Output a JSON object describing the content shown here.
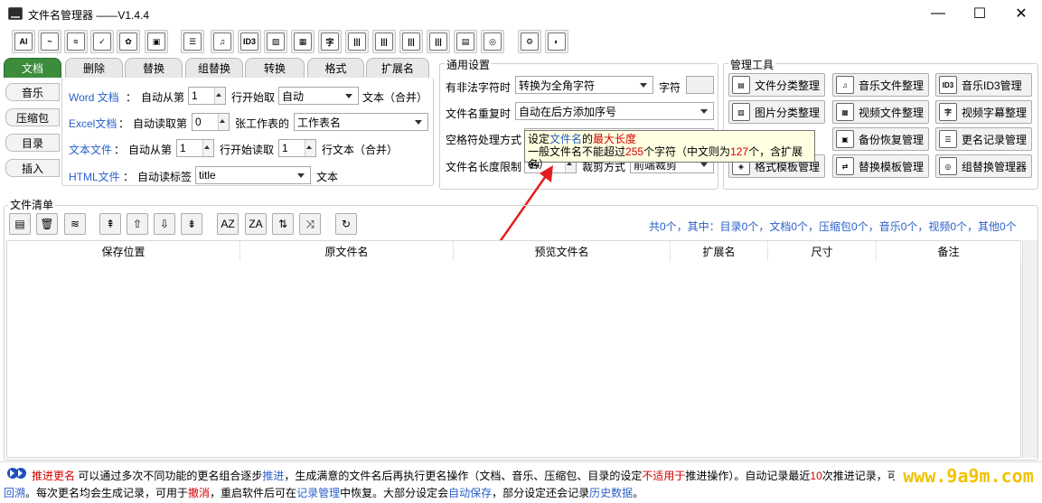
{
  "window": {
    "title": "文件名管理器 ——V1.4.4",
    "minimize": "—",
    "maximize": "☐",
    "close": "✕"
  },
  "toolbar": {
    "buttons": [
      "AI",
      "~",
      "≈",
      "✓",
      "✿",
      "▣",
      "☰",
      "♫",
      "ID3",
      "▨",
      "▦",
      "字",
      "|||",
      "|||",
      "|||",
      "|||",
      "▤",
      "◎",
      "⚙",
      "◐"
    ]
  },
  "tabs": [
    "文档",
    "删除",
    "替换",
    "组替换",
    "转换",
    "格式",
    "扩展名"
  ],
  "side_tabs": [
    "音乐",
    "压缩包",
    "目录",
    "插入"
  ],
  "doc": {
    "word": {
      "label": "Word 文档",
      "colon": "：",
      "text1": "自动从第",
      "value": "1",
      "text2": "行开始取",
      "mode": "自动",
      "text3": "文本（合并）"
    },
    "excel": {
      "label": "Excel文档",
      "colon": "：",
      "text1": "自动读取第",
      "value": "0",
      "text2": "张工作表的",
      "sheet": "工作表名"
    },
    "text": {
      "label": "文本文件",
      "colon": "：",
      "text1": "自动从第",
      "value": "1",
      "text2": "行开始读取",
      "value2": "1",
      "text3": "行文本（合并）"
    },
    "html": {
      "label": "HTML文件",
      "colon": "：",
      "text1": "自动读标签",
      "tag": "title",
      "text2": "文本"
    }
  },
  "general": {
    "title": "通用设置",
    "illegal_label": "有非法字符时",
    "illegal_value": "转换为全角字符",
    "char_label": "字符",
    "dup_label": "文件名重复时",
    "dup_value": "自动在后方添加序号",
    "space_label": "空格符处理方式",
    "len_label": "文件名长度限制",
    "len_value": "64",
    "cut_label": "裁剪方式",
    "cut_value": "前端裁剪"
  },
  "tooltip": {
    "l1a": "设定",
    "l1b": "文件名",
    "l1c": "的",
    "l1d": "最大长度",
    "l2a": "一般文件名不能超过",
    "l2b": "255",
    "l2c": "个字符（中文则为",
    "l2d": "127",
    "l2e": "个，含扩展名）"
  },
  "manage": {
    "title": "管理工具",
    "buttons": [
      {
        "icon": "▤",
        "label": "文件分类整理"
      },
      {
        "icon": "♫",
        "label": "音乐文件整理"
      },
      {
        "icon": "ID3",
        "label": "音乐ID3管理"
      },
      {
        "icon": "▨",
        "label": "图片分类整理"
      },
      {
        "icon": "▦",
        "label": "视频文件整理"
      },
      {
        "icon": "字",
        "label": "视频字幕整理"
      },
      {
        "icon": "▣",
        "label": "备份恢复管理"
      },
      {
        "icon": "☰",
        "label": "更名记录管理"
      },
      {
        "icon": "◈",
        "label": "格式模板管理"
      },
      {
        "icon": "⇄",
        "label": "替换模板管理"
      },
      {
        "icon": "◎",
        "label": "组替换管理器"
      }
    ]
  },
  "filelist": {
    "title": "文件清单",
    "buttons": [
      "▤",
      "🗑",
      "≋",
      "⇞",
      "⇧",
      "⇩",
      "⇟",
      "AZ",
      "ZA",
      "⇅",
      "⤨",
      "↻"
    ],
    "stats": "共0个，其中：目录0个，文档0个，压缩包0个，音乐0个，视频0个，其他0个",
    "columns": [
      "保存位置",
      "原文件名",
      "预览文件名",
      "扩展名",
      "尺寸",
      "备注"
    ]
  },
  "status": {
    "s1": "推进更名",
    "s2": " 可以通过多次不同功能的更名组合逐步",
    "s3": "推进",
    "s4": "，生成满意的文件名后再执行更名操作（文档、音乐、压缩包、目录的设定",
    "s5": "不适用于",
    "s6": "推进操作）。自动记录最近",
    "s7": "10",
    "s8": "次推进记录，可",
    "s9": "回溯",
    "s10": "。每次更名均会生成记录，可用于",
    "s11": "撤消",
    "s12": "，重启软件后可在",
    "s13": "记录管理",
    "s14": "中恢复。大部分设定会",
    "s15": "自动保存",
    "s16": "，部分设定还会记录",
    "s17": "历史数据",
    "s18": "。"
  },
  "watermark": "www.9a9m.com",
  "colors": {
    "accent_green": "#3c8c3c",
    "link_blue": "#2a5fc9",
    "emphasis_red": "#d40000",
    "arrow_red": "#e02020",
    "watermark_yellow": "#f2c200"
  }
}
